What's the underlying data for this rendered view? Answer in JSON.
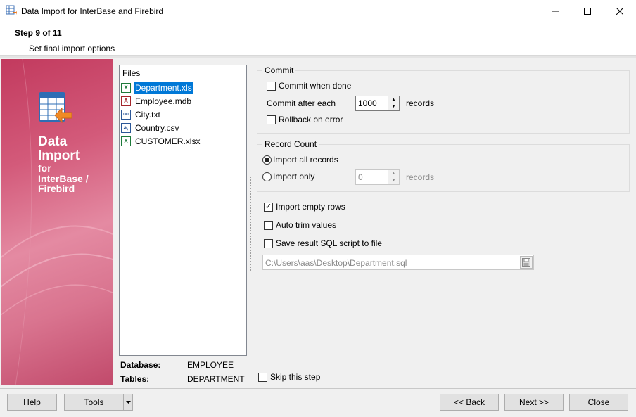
{
  "window": {
    "title": "Data Import for InterBase and Firebird",
    "controls": {
      "minimize": "—",
      "maximize": "☐",
      "close": "✕"
    }
  },
  "header": {
    "step": "Step 9 of 11",
    "subtitle": "Set final import options"
  },
  "banner": {
    "line1": "Data",
    "line2": "Import",
    "line3": "for",
    "line4": "InterBase /",
    "line5": "Firebird"
  },
  "files": {
    "header": "Files",
    "items": [
      {
        "label": "Department.xls",
        "icon": "X",
        "color": "#1d7a3a"
      },
      {
        "label": "Employee.mdb",
        "icon": "A",
        "color": "#a4262c"
      },
      {
        "label": "City.txt",
        "icon": "TXT",
        "color": "#2b5797"
      },
      {
        "label": "Country.csv",
        "icon": "a,",
        "color": "#2b5797"
      },
      {
        "label": "CUSTOMER.xlsx",
        "icon": "X",
        "color": "#1d7a3a"
      }
    ]
  },
  "info": {
    "database_label": "Database:",
    "database_value": "EMPLOYEE",
    "tables_label": "Tables:",
    "tables_value": "DEPARTMENT"
  },
  "commit": {
    "title": "Commit",
    "commit_when_done": "Commit when done",
    "commit_after_each": "Commit after each",
    "commit_after_value": "1000",
    "records": "records",
    "rollback_on_error": "Rollback on error"
  },
  "record_count": {
    "title": "Record Count",
    "import_all": "Import all records",
    "import_only": "Import only",
    "import_only_value": "0",
    "records": "records"
  },
  "options": {
    "import_empty_rows": "Import empty rows",
    "auto_trim_values": "Auto trim values",
    "save_sql_script": "Save result SQL script to file",
    "sql_path": "C:\\Users\\aas\\Desktop\\Department.sql"
  },
  "skip_step": "Skip this step",
  "buttons": {
    "help": "Help",
    "tools": "Tools",
    "back": "<< Back",
    "next": "Next >>",
    "close": "Close"
  },
  "colors": {
    "selection": "#0078d7",
    "banner": "#d35a7a"
  }
}
